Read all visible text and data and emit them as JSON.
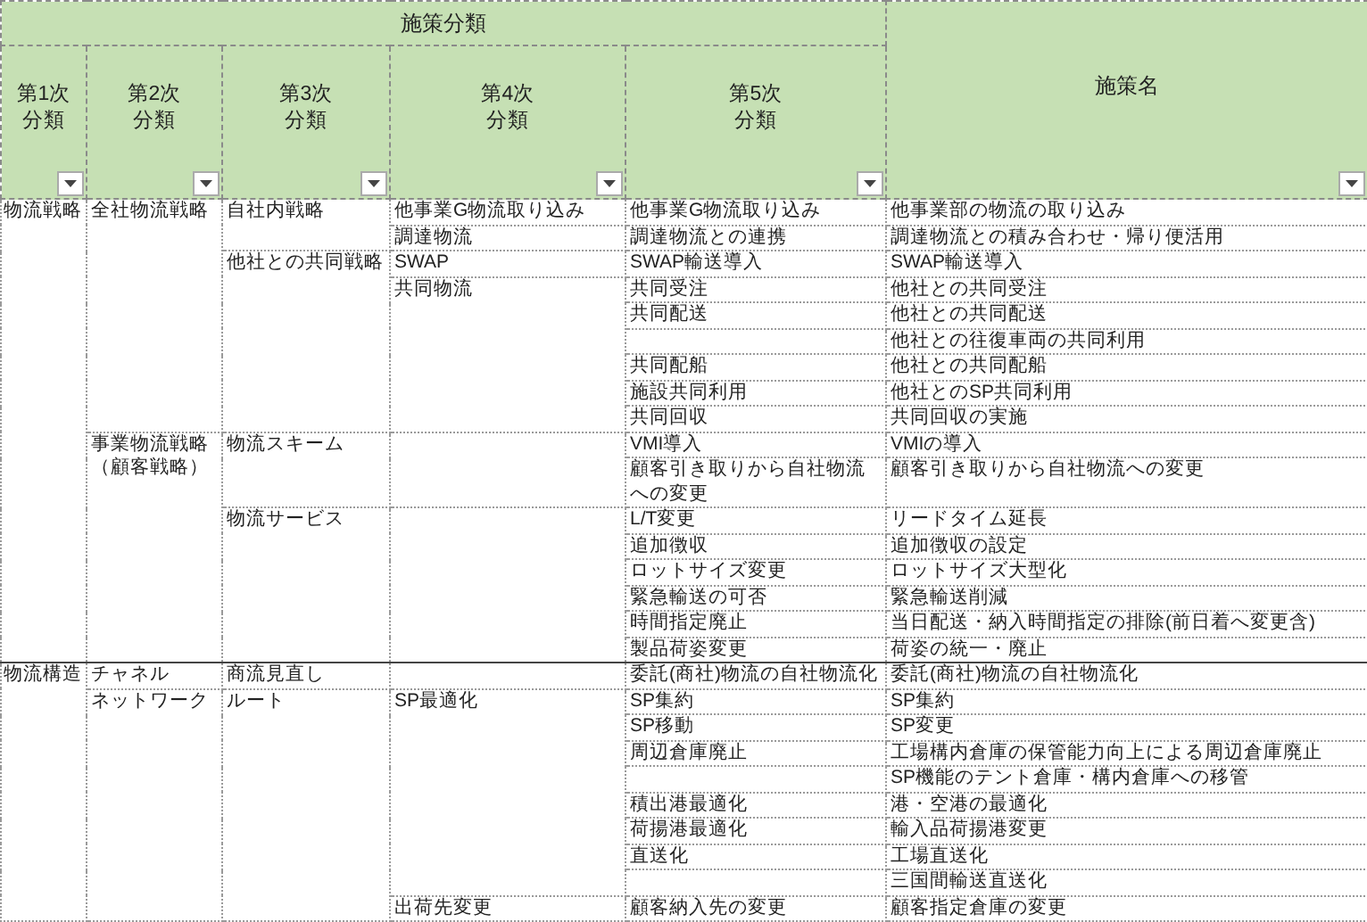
{
  "header": {
    "group_title": "施策分類",
    "columns": [
      {
        "lines": [
          "第1次",
          "分類"
        ],
        "filter": true
      },
      {
        "lines": [
          "第2次",
          "分類"
        ],
        "filter": true
      },
      {
        "lines": [
          "第3次",
          "分類"
        ],
        "filter": true
      },
      {
        "lines": [
          "第4次",
          "分類"
        ],
        "filter": true
      },
      {
        "lines": [
          "第5次",
          "分類"
        ],
        "filter": true
      },
      {
        "lines": [
          "施策名"
        ],
        "filter": true
      }
    ]
  },
  "rows": [
    {
      "label": "物流戦略",
      "children": [
        {
          "label": "全社物流戦略",
          "children": [
            {
              "label": "自社内戦略",
              "children": [
                {
                  "label": "他事業G物流取り込み",
                  "children": [
                    {
                      "class_5": "他事業G物流取り込み",
                      "measure": "他事業部の物流の取り込み"
                    }
                  ]
                },
                {
                  "label": "調達物流",
                  "children": [
                    {
                      "class_5": "調達物流との連携",
                      "measure": "調達物流との積み合わせ・帰り便活用"
                    }
                  ]
                }
              ]
            },
            {
              "label": "他社との共同戦略",
              "children": [
                {
                  "label": "SWAP",
                  "children": [
                    {
                      "class_5": "SWAP輸送導入",
                      "measure": "SWAP輸送導入"
                    }
                  ]
                },
                {
                  "label": "共同物流",
                  "children": [
                    {
                      "class_5": "共同受注",
                      "measure": "他社との共同受注"
                    },
                    {
                      "class_5": "共同配送",
                      "measure": "他社との共同配送"
                    },
                    {
                      "measure": "他社との往復車両の共同利用"
                    },
                    {
                      "class_5": "共同配船",
                      "measure": "他社との共同配船"
                    },
                    {
                      "class_5": "施設共同利用",
                      "measure": "他社とのSP共同利用"
                    },
                    {
                      "class_5": "共同回収",
                      "measure": "共同回収の実施"
                    }
                  ]
                }
              ]
            }
          ]
        },
        {
          "label": "事業物流戦略（顧客戦略）",
          "children": [
            {
              "label": "物流スキーム",
              "children": [
                {
                  "children": [
                    {
                      "class_5": "VMI導入",
                      "measure": "VMIの導入"
                    },
                    {
                      "class_5": "顧客引き取りから自社物流への変更",
                      "measure": "顧客引き取りから自社物流への変更"
                    }
                  ]
                }
              ]
            },
            {
              "label": "物流サービス",
              "children": [
                {
                  "children": [
                    {
                      "class_5": "L/T変更",
                      "measure": "リードタイム延長"
                    },
                    {
                      "class_5": "追加徴収",
                      "measure": "追加徴収の設定"
                    },
                    {
                      "class_5": "ロットサイズ変更",
                      "measure": "ロットサイズ大型化"
                    },
                    {
                      "class_5": "緊急輸送の可否",
                      "measure": "緊急輸送削減"
                    },
                    {
                      "class_5": "時間指定廃止",
                      "measure": "当日配送・納入時間指定の排除(前日着へ変更含)"
                    },
                    {
                      "class_5": "製品荷姿変更",
                      "measure": "荷姿の統一・廃止"
                    }
                  ]
                }
              ]
            }
          ]
        }
      ]
    },
    {
      "label": "物流構造",
      "children": [
        {
          "label": "チャネル",
          "children": [
            {
              "label": "商流見直し",
              "children": [
                {
                  "children": [
                    {
                      "class_5": "委託(商社)物流の自社物流化",
                      "measure": "委託(商社)物流の自社物流化"
                    }
                  ]
                }
              ]
            }
          ]
        },
        {
          "label": "ネットワーク",
          "children": [
            {
              "label": "ルート",
              "children": [
                {
                  "label": "SP最適化",
                  "children": [
                    {
                      "class_5": "SP集約",
                      "measure": "SP集約"
                    },
                    {
                      "class_5": "SP移動",
                      "measure": "SP変更"
                    },
                    {
                      "class_5": "周辺倉庫廃止",
                      "measure": "工場構内倉庫の保管能力向上による周辺倉庫廃止"
                    },
                    {
                      "measure": "SP機能のテント倉庫・構内倉庫への移管"
                    },
                    {
                      "class_5": "積出港最適化",
                      "measure": "港・空港の最適化"
                    },
                    {
                      "class_5": "荷揚港最適化",
                      "measure": "輸入品荷揚港変更"
                    },
                    {
                      "class_5": "直送化",
                      "measure": "工場直送化"
                    },
                    {
                      "measure": "三国間輸送直送化"
                    }
                  ]
                },
                {
                  "label": "出荷先変更",
                  "children": [
                    {
                      "class_5": "顧客納入先の変更",
                      "measure": "顧客指定倉庫の変更"
                    }
                  ]
                }
              ]
            }
          ]
        }
      ]
    }
  ]
}
